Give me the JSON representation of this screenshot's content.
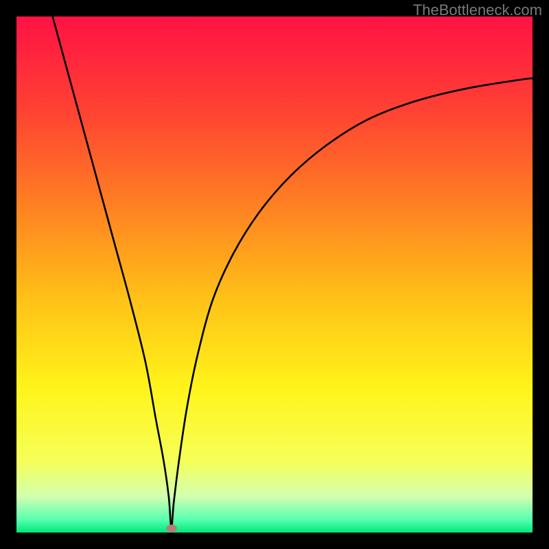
{
  "watermark": "TheBottleneck.com",
  "chart_data": {
    "type": "line",
    "title": "",
    "xlabel": "",
    "ylabel": "",
    "xlim": [
      0,
      100
    ],
    "ylim": [
      0,
      100
    ],
    "grid": false,
    "legend": false,
    "background_gradient": {
      "stops": [
        {
          "pos": 0.0,
          "color": "#ff1244"
        },
        {
          "pos": 0.18,
          "color": "#ff4133"
        },
        {
          "pos": 0.36,
          "color": "#ff7e23"
        },
        {
          "pos": 0.55,
          "color": "#ffc217"
        },
        {
          "pos": 0.72,
          "color": "#fff41a"
        },
        {
          "pos": 0.86,
          "color": "#f6ff57"
        },
        {
          "pos": 0.93,
          "color": "#d2ffb0"
        },
        {
          "pos": 0.975,
          "color": "#57ffb0"
        },
        {
          "pos": 1.0,
          "color": "#00e878"
        }
      ]
    },
    "series": [
      {
        "name": "bottleneck-curve",
        "color": "#000000",
        "width": 2,
        "x": [
          7,
          10,
          13,
          16,
          19,
          22,
          25,
          27,
          28.5,
          29.5,
          30,
          30.5,
          31.5,
          33,
          35,
          38,
          42,
          47,
          53,
          60,
          68,
          77,
          87,
          98,
          100
        ],
        "y": [
          100,
          89,
          78,
          67,
          56,
          45,
          33,
          22,
          14,
          7,
          1,
          6,
          14,
          24,
          34,
          45,
          54,
          62,
          69,
          75,
          80,
          83.5,
          86,
          87.8,
          88
        ]
      }
    ],
    "marker": {
      "x": 30,
      "y": 0.8,
      "color": "#bb7a79"
    }
  }
}
